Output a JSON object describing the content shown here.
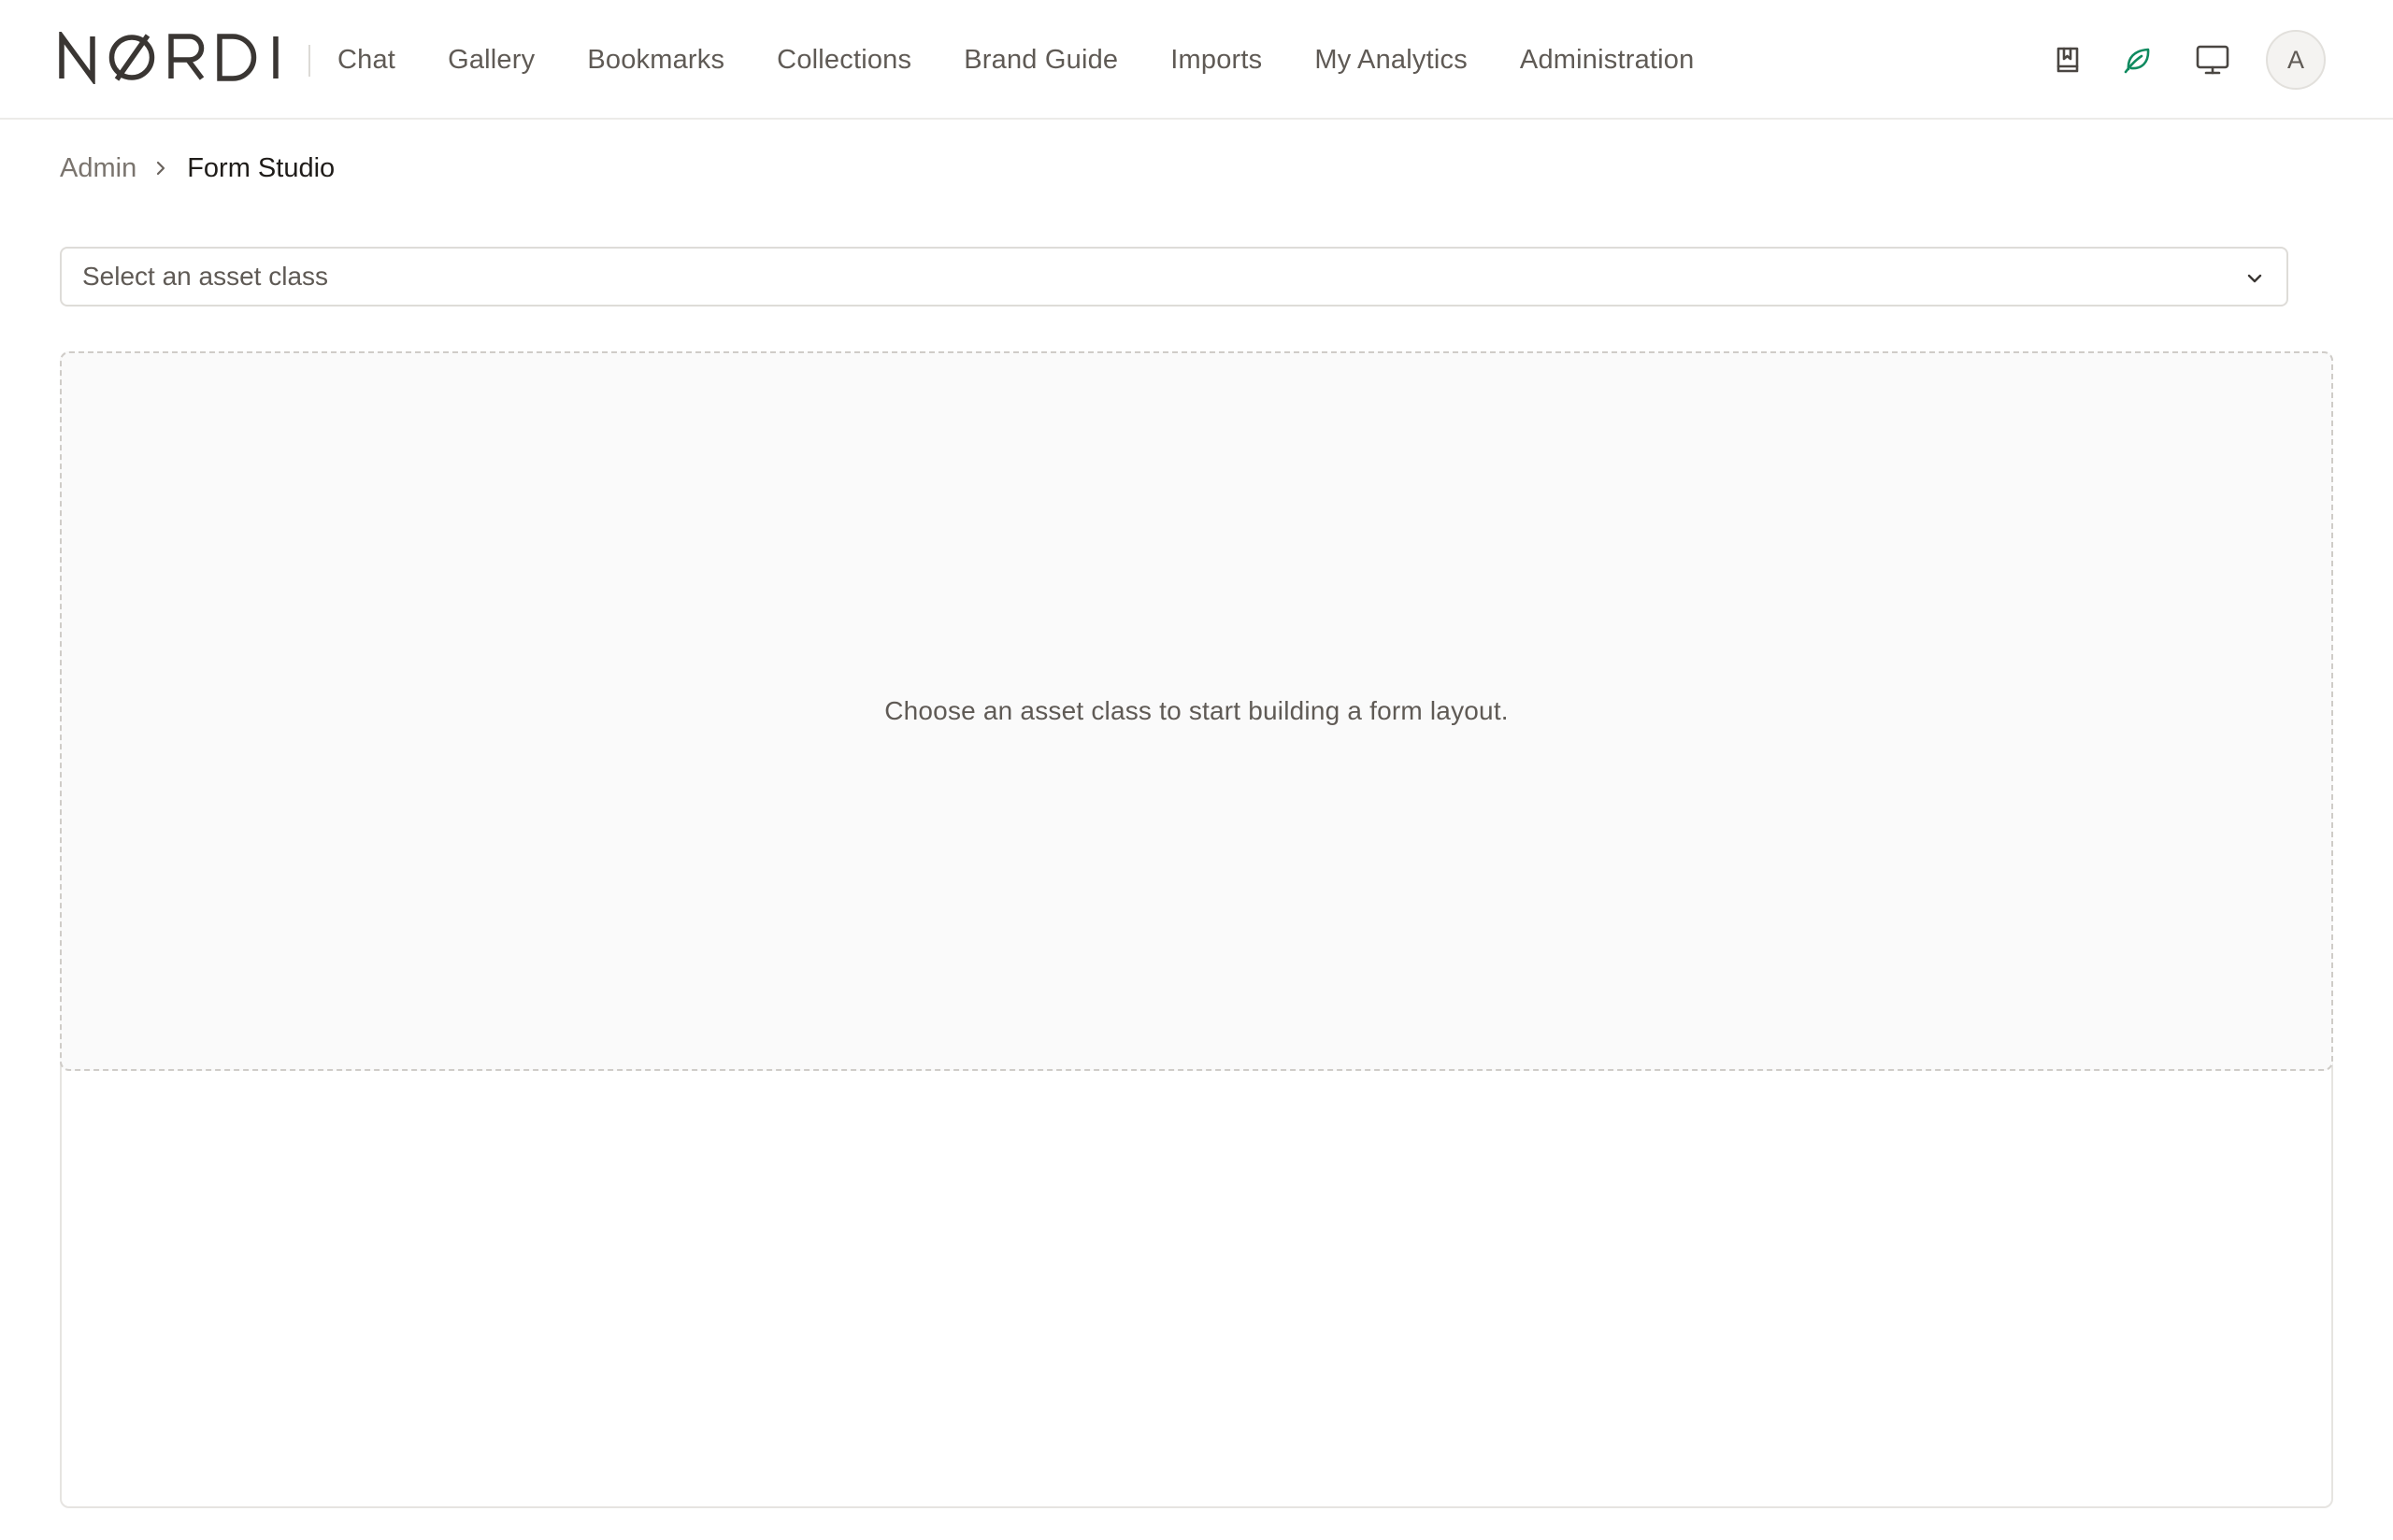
{
  "brand": {
    "logo_text": "NØRDI"
  },
  "nav": {
    "items": [
      {
        "label": "Chat"
      },
      {
        "label": "Gallery"
      },
      {
        "label": "Bookmarks"
      },
      {
        "label": "Collections"
      },
      {
        "label": "Brand Guide"
      },
      {
        "label": "Imports"
      },
      {
        "label": "My Analytics"
      },
      {
        "label": "Administration"
      }
    ]
  },
  "header_icons": {
    "bookmark": "bookmark-book-icon",
    "leaf": "leaf-icon",
    "display": "monitor-icon",
    "leaf_color": "#0f8a5f"
  },
  "user": {
    "avatar_initial": "A"
  },
  "breadcrumb": {
    "parent": "Admin",
    "current": "Form Studio"
  },
  "asset_class_select": {
    "placeholder": "Select an asset class",
    "selected": ""
  },
  "canvas": {
    "empty_message": "Choose an asset class to start building a form layout."
  }
}
